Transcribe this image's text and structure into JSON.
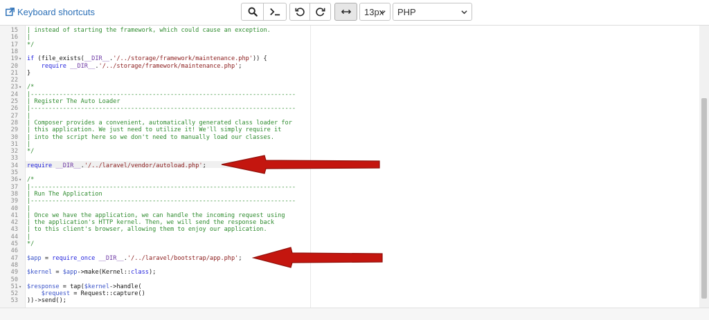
{
  "toolbar": {
    "shortcuts_label": "Keyboard shortcuts",
    "font_size": "13px",
    "language": "PHP"
  },
  "editor": {
    "lines": [
      {
        "n": "15",
        "fold": false,
        "parts": [
          [
            "c",
            "| instead of starting the framework, which could cause an exception."
          ]
        ]
      },
      {
        "n": "16",
        "fold": false,
        "parts": [
          [
            "c",
            "|"
          ]
        ]
      },
      {
        "n": "17",
        "fold": false,
        "parts": [
          [
            "c",
            "*/"
          ]
        ]
      },
      {
        "n": "18",
        "fold": false,
        "parts": []
      },
      {
        "n": "19",
        "fold": true,
        "parts": [
          [
            "k",
            "if"
          ],
          [
            "f",
            " (file_exists("
          ],
          [
            "cst",
            "__DIR__"
          ],
          [
            "f",
            "."
          ],
          [
            "s",
            "'/../storage/framework/maintenance.php'"
          ],
          [
            "f",
            ")) {"
          ]
        ]
      },
      {
        "n": "20",
        "fold": false,
        "parts": [
          [
            "f",
            "    "
          ],
          [
            "k",
            "require"
          ],
          [
            "f",
            " "
          ],
          [
            "cst",
            "__DIR__"
          ],
          [
            "f",
            "."
          ],
          [
            "s",
            "'/../storage/framework/maintenance.php'"
          ],
          [
            "f",
            ";"
          ]
        ]
      },
      {
        "n": "21",
        "fold": false,
        "parts": [
          [
            "f",
            "}"
          ]
        ]
      },
      {
        "n": "22",
        "fold": false,
        "parts": []
      },
      {
        "n": "23",
        "fold": true,
        "parts": [
          [
            "c",
            "/*"
          ]
        ]
      },
      {
        "n": "24",
        "fold": false,
        "parts": [
          [
            "c",
            "|--------------------------------------------------------------------------"
          ]
        ]
      },
      {
        "n": "25",
        "fold": false,
        "parts": [
          [
            "c",
            "| Register The Auto Loader"
          ]
        ]
      },
      {
        "n": "26",
        "fold": false,
        "parts": [
          [
            "c",
            "|--------------------------------------------------------------------------"
          ]
        ]
      },
      {
        "n": "27",
        "fold": false,
        "parts": [
          [
            "c",
            "|"
          ]
        ]
      },
      {
        "n": "28",
        "fold": false,
        "parts": [
          [
            "c",
            "| Composer provides a convenient, automatically generated class loader for"
          ]
        ]
      },
      {
        "n": "29",
        "fold": false,
        "parts": [
          [
            "c",
            "| this application. We just need to utilize it! We'll simply require it"
          ]
        ]
      },
      {
        "n": "30",
        "fold": false,
        "parts": [
          [
            "c",
            "| into the script here so we don't need to manually load our classes."
          ]
        ]
      },
      {
        "n": "31",
        "fold": false,
        "parts": [
          [
            "c",
            "|"
          ]
        ]
      },
      {
        "n": "32",
        "fold": false,
        "parts": [
          [
            "c",
            "*/"
          ]
        ]
      },
      {
        "n": "33",
        "fold": false,
        "parts": []
      },
      {
        "n": "34",
        "fold": false,
        "parts": [
          [
            "k",
            "require"
          ],
          [
            "f",
            " "
          ],
          [
            "cst",
            "__DIR__"
          ],
          [
            "f",
            "."
          ],
          [
            "s",
            "'/../laravel/vendor/autoload.php'"
          ],
          [
            "f",
            ";"
          ]
        ]
      },
      {
        "n": "35",
        "fold": false,
        "parts": []
      },
      {
        "n": "36",
        "fold": true,
        "parts": [
          [
            "c",
            "/*"
          ]
        ]
      },
      {
        "n": "37",
        "fold": false,
        "parts": [
          [
            "c",
            "|--------------------------------------------------------------------------"
          ]
        ]
      },
      {
        "n": "38",
        "fold": false,
        "parts": [
          [
            "c",
            "| Run The Application"
          ]
        ]
      },
      {
        "n": "39",
        "fold": false,
        "parts": [
          [
            "c",
            "|--------------------------------------------------------------------------"
          ]
        ]
      },
      {
        "n": "40",
        "fold": false,
        "parts": [
          [
            "c",
            "|"
          ]
        ]
      },
      {
        "n": "41",
        "fold": false,
        "parts": [
          [
            "c",
            "| Once we have the application, we can handle the incoming request using"
          ]
        ]
      },
      {
        "n": "42",
        "fold": false,
        "parts": [
          [
            "c",
            "| the application's HTTP kernel. Then, we will send the response back"
          ]
        ]
      },
      {
        "n": "43",
        "fold": false,
        "parts": [
          [
            "c",
            "| to this client's browser, allowing them to enjoy our application."
          ]
        ]
      },
      {
        "n": "44",
        "fold": false,
        "parts": [
          [
            "c",
            "|"
          ]
        ]
      },
      {
        "n": "45",
        "fold": false,
        "parts": [
          [
            "c",
            "*/"
          ]
        ]
      },
      {
        "n": "46",
        "fold": false,
        "parts": []
      },
      {
        "n": "47",
        "fold": false,
        "parts": [
          [
            "v",
            "$app"
          ],
          [
            "f",
            " = "
          ],
          [
            "k",
            "require_once"
          ],
          [
            "f",
            " "
          ],
          [
            "cst",
            "__DIR__"
          ],
          [
            "f",
            "."
          ],
          [
            "s",
            "'/../laravel/bootstrap/app.php'"
          ],
          [
            "f",
            ";"
          ]
        ]
      },
      {
        "n": "48",
        "fold": false,
        "parts": []
      },
      {
        "n": "49",
        "fold": false,
        "parts": [
          [
            "v",
            "$kernel"
          ],
          [
            "f",
            " = "
          ],
          [
            "v",
            "$app"
          ],
          [
            "f",
            "->make(Kernel::"
          ],
          [
            "k",
            "class"
          ],
          [
            "f",
            ");"
          ]
        ]
      },
      {
        "n": "50",
        "fold": false,
        "parts": []
      },
      {
        "n": "51",
        "fold": true,
        "parts": [
          [
            "v",
            "$response"
          ],
          [
            "f",
            " = tap("
          ],
          [
            "v",
            "$kernel"
          ],
          [
            "f",
            "->handle("
          ]
        ]
      },
      {
        "n": "52",
        "fold": false,
        "parts": [
          [
            "f",
            "    "
          ],
          [
            "v",
            "$request"
          ],
          [
            "f",
            " = Request::capture()"
          ]
        ]
      },
      {
        "n": "53",
        "fold": false,
        "parts": [
          [
            "f",
            "))->send();"
          ]
        ]
      }
    ]
  },
  "colors": {
    "comment": "#2e8b2e",
    "keyword": "#1e1edc",
    "string": "#8a1a1a",
    "variable": "#3a53c9",
    "arrow": "#c4160f"
  },
  "icons": [
    "external-link-icon",
    "search-icon",
    "terminal-icon",
    "undo-icon",
    "redo-icon",
    "wrap-icon",
    "chevron-down-icon",
    "red-arrow"
  ]
}
